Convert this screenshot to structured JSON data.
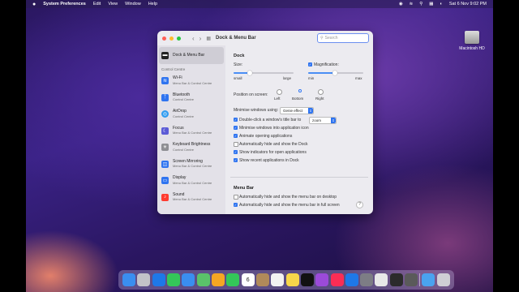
{
  "menubar": {
    "apple_icon": "apple-icon",
    "app_name": "System Preferences",
    "items": [
      "Edit",
      "View",
      "Window",
      "Help"
    ],
    "status_icons": [
      "record-icon",
      "wifi-icon",
      "search-icon",
      "control-center-icon",
      "siri-icon"
    ],
    "clock": "Sat 6 Nov  9:02 PM"
  },
  "desktop": {
    "hd_label": "Macintosh HD"
  },
  "window": {
    "title": "Dock & Menu Bar",
    "search_placeholder": "Search",
    "traffic_colors": [
      "#fe5f57",
      "#febb2e",
      "#28c840"
    ]
  },
  "sidebar": {
    "selected": {
      "label": "Dock & Menu Bar",
      "icon": "dock-icon"
    },
    "section_header": "Control Centre",
    "items": [
      {
        "label": "Wi-Fi",
        "sub": "Menu Bar & Control Centre",
        "icon": "wifi-icon",
        "color": "#2f74f0"
      },
      {
        "label": "Bluetooth",
        "sub": "Control Centre",
        "icon": "bluetooth-icon",
        "color": "#2f74f0"
      },
      {
        "label": "AirDrop",
        "sub": "Control Centre",
        "icon": "airdrop-icon",
        "color": "#2f9bf0"
      },
      {
        "label": "Focus",
        "sub": "Menu Bar & Control Centre",
        "icon": "moon-icon",
        "color": "#5b5bd6"
      },
      {
        "label": "Keyboard Brightness",
        "sub": "Control Centre",
        "icon": "keyboard-icon",
        "color": "#8e8e93"
      },
      {
        "label": "Screen Mirroring",
        "sub": "Menu Bar & Control Centre",
        "icon": "screen-mirroring-icon",
        "color": "#2f74f0"
      },
      {
        "label": "Display",
        "sub": "Menu Bar & Control Centre",
        "icon": "display-icon",
        "color": "#2f74f0"
      },
      {
        "label": "Sound",
        "sub": "Menu Bar & Control Centre",
        "icon": "speaker-icon",
        "color": "#ff3b30"
      }
    ]
  },
  "dock_settings": {
    "heading": "Dock",
    "size": {
      "label": "Size:",
      "min_label": "small",
      "max_label": "large",
      "value": 0.27
    },
    "magnification": {
      "label": "Magnification:",
      "checked": true,
      "min_label": "min",
      "max_label": "max",
      "value": 0.48
    },
    "position": {
      "label": "Position on screen:",
      "options": [
        "Left",
        "Bottom",
        "Right"
      ],
      "selected": "Bottom"
    },
    "minimise": {
      "label": "Minimise windows using:",
      "value": "Genie effect"
    },
    "double_click": {
      "label": "Double-click a window's title bar to",
      "value": "zoom",
      "checked": true
    },
    "checkboxes": [
      {
        "label": "Minimise windows into application icon",
        "checked": true
      },
      {
        "label": "Animate opening applications",
        "checked": true
      },
      {
        "label": "Automatically hide and show the Dock",
        "checked": false
      },
      {
        "label": "Show indicators for open applications",
        "checked": true
      },
      {
        "label": "Show recent applications in Dock",
        "checked": true
      }
    ]
  },
  "menubar_settings": {
    "heading": "Menu Bar",
    "checkboxes": [
      {
        "label": "Automatically hide and show the menu bar on desktop",
        "checked": false
      },
      {
        "label": "Automatically hide and show the menu bar in full screen",
        "checked": true
      }
    ],
    "help": "?"
  },
  "dock": {
    "apps": [
      {
        "name": "finder-icon",
        "color": "#3a8ef0"
      },
      {
        "name": "launchpad-icon",
        "color": "#c2c2c8"
      },
      {
        "name": "safari-icon",
        "color": "#1e78e8"
      },
      {
        "name": "messages-icon",
        "color": "#34c759"
      },
      {
        "name": "mail-icon",
        "color": "#3a8ef0"
      },
      {
        "name": "maps-icon",
        "color": "#5ac26a"
      },
      {
        "name": "photos-icon",
        "color": "#f5a623"
      },
      {
        "name": "facetime-icon",
        "color": "#34c759"
      },
      {
        "name": "calendar-icon",
        "color": "#ffffff"
      },
      {
        "name": "contacts-icon",
        "color": "#b08a5a"
      },
      {
        "name": "reminders-icon",
        "color": "#f2f2f2"
      },
      {
        "name": "notes-icon",
        "color": "#f7d74a"
      },
      {
        "name": "tv-icon",
        "color": "#111111"
      },
      {
        "name": "podcasts-icon",
        "color": "#9b4ad9"
      },
      {
        "name": "music-icon",
        "color": "#fa2d55"
      },
      {
        "name": "app-store-icon",
        "color": "#1e78e8"
      },
      {
        "name": "system-preferences-icon",
        "color": "#7d7d85"
      },
      {
        "name": "chrome-icon",
        "color": "#e8e8e8"
      },
      {
        "name": "claquette-icon",
        "color": "#2b2b2b"
      },
      {
        "name": "final-cut-icon",
        "color": "#5a5a5a"
      },
      {
        "name": "folder-icon",
        "color": "#4aa3ef"
      },
      {
        "name": "trash-icon",
        "color": "#cfcfd5"
      }
    ],
    "calendar_day": "6"
  }
}
